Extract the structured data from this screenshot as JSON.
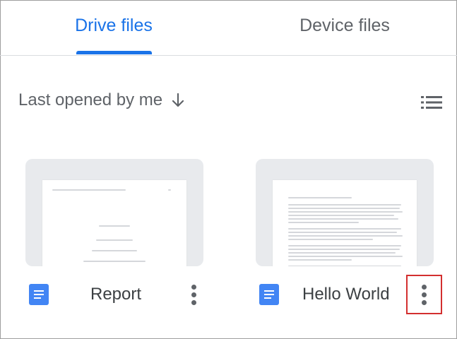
{
  "tabs": [
    {
      "label": "Drive files",
      "active": true
    },
    {
      "label": "Device files",
      "active": false
    }
  ],
  "sort": {
    "label": "Last opened by me",
    "direction_icon": "arrow-down-icon"
  },
  "view_toggle_icon": "list-view-icon",
  "files": [
    {
      "name": "Report",
      "icon": "docs-icon",
      "menu_icon": "more-vert-icon"
    },
    {
      "name": "Hello World",
      "icon": "docs-icon",
      "menu_icon": "more-vert-icon",
      "highlighted": true
    }
  ],
  "colors": {
    "accent": "#1a73e8",
    "docs_icon": "#4285f4",
    "highlight": "#d32f2f",
    "text_secondary": "#5f6368"
  }
}
